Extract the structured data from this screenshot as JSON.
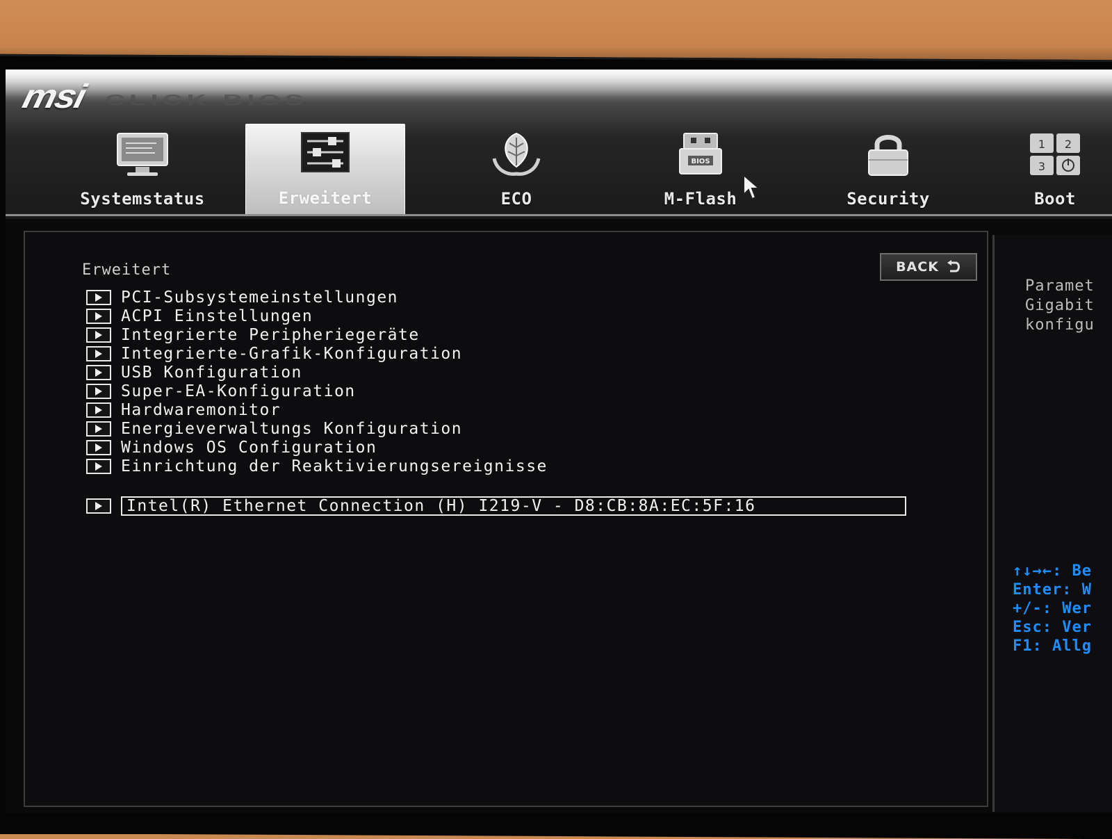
{
  "brand": {
    "logo": "msi",
    "subtitle": "CLICK BIOS"
  },
  "tabs": [
    {
      "label": "Systemstatus",
      "icon": "monitor-icon",
      "active": false
    },
    {
      "label": "Erweitert",
      "icon": "sliders-icon",
      "active": true
    },
    {
      "label": "ECO",
      "icon": "leaf-icon",
      "active": false
    },
    {
      "label": "M-Flash",
      "icon": "usb-bios-icon",
      "active": false
    },
    {
      "label": "Security",
      "icon": "padlock-icon",
      "active": false
    },
    {
      "label": "Boot",
      "icon": "boot-order-icon",
      "active": false
    }
  ],
  "main": {
    "section_title": "Erweitert",
    "back_label": "BACK",
    "menu_items": [
      "PCI-Subsystemeinstellungen",
      "ACPI Einstellungen",
      "Integrierte Peripheriegeräte",
      "Integrierte-Grafik-Konfiguration",
      "USB Konfiguration",
      "Super-EA-Konfiguration",
      "Hardwaremonitor",
      "Energieverwaltungs Konfiguration",
      "Windows OS Configuration",
      "Einrichtung der Reaktivierungsereignisse"
    ],
    "selected_item": "Intel(R) Ethernet Connection (H) I219-V - D8:CB:8A:EC:5F:16"
  },
  "help": {
    "lines": [
      "Paramet",
      "Gigabit",
      "konfigu"
    ],
    "keys": [
      "↑↓→←: Be",
      "Enter: W",
      "+/-: Wer",
      "Esc: Ver",
      "F1: Allg"
    ]
  },
  "colors": {
    "accent_blue": "#1f8dff",
    "text": "#f2f2f2"
  }
}
